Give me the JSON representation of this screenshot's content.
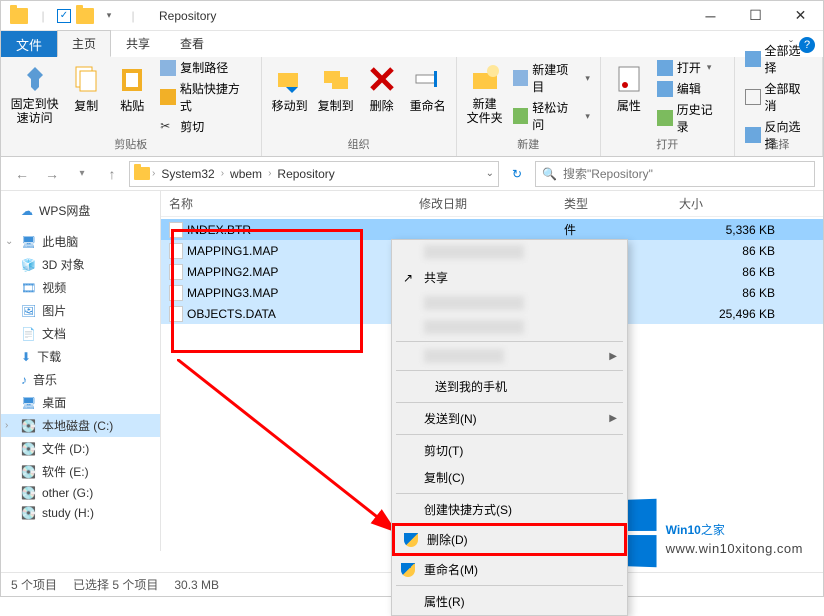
{
  "window": {
    "title": "Repository"
  },
  "tabs": {
    "file": "文件",
    "home": "主页",
    "share": "共享",
    "view": "查看"
  },
  "ribbon": {
    "pin": "固定到快\n速访问",
    "copy": "复制",
    "paste": "粘贴",
    "copypath": "复制路径",
    "pasteshortcut": "粘贴快捷方式",
    "cut": "剪切",
    "clipboard": "剪贴板",
    "moveto": "移动到",
    "copyto": "复制到",
    "delete": "删除",
    "rename": "重命名",
    "organize": "组织",
    "newfolder": "新建\n文件夹",
    "newitem": "新建项目",
    "easyaccess": "轻松访问",
    "new": "新建",
    "properties": "属性",
    "open": "打开",
    "edit": "编辑",
    "history": "历史记录",
    "opengrp": "打开",
    "selectall": "全部选择",
    "selectnone": "全部取消",
    "invertsel": "反向选择",
    "select": "选择"
  },
  "breadcrumb": {
    "seg1": "System32",
    "seg2": "wbem",
    "seg3": "Repository"
  },
  "search": {
    "placeholder": "搜索\"Repository\""
  },
  "columns": {
    "name": "名称",
    "date": "修改日期",
    "type": "类型",
    "size": "大小"
  },
  "sidebar": {
    "wps": "WPS网盘",
    "pc": "此电脑",
    "d3": "3D 对象",
    "video": "视频",
    "pic": "图片",
    "doc": "文档",
    "dl": "下载",
    "music": "音乐",
    "desktop": "桌面",
    "drivec": "本地磁盘 (C:)",
    "drived": "文件 (D:)",
    "drivee": "软件 (E:)",
    "driveg": "other (G:)",
    "driveh": "study (H:)"
  },
  "files": [
    {
      "name": "INDEX.BTR",
      "size": "5,336 KB"
    },
    {
      "name": "MAPPING1.MAP",
      "size": "86 KB"
    },
    {
      "name": "MAPPING2.MAP",
      "size": "86 KB"
    },
    {
      "name": "MAPPING3.MAP",
      "size": "86 KB"
    },
    {
      "name": "OBJECTS.DATA",
      "size": "25,496 KB"
    }
  ],
  "context": {
    "share": "共享",
    "sendphone": "送到我的手机",
    "sendto": "发送到(N)",
    "cut": "剪切(T)",
    "copy": "复制(C)",
    "shortcut": "创建快捷方式(S)",
    "delete": "删除(D)",
    "rename": "重命名(M)",
    "props": "属性(R)"
  },
  "status": {
    "items": "5 个项目",
    "selected": "已选择 5 个项目",
    "size": "30.3 MB"
  },
  "watermark": {
    "title_a": "Win10",
    "title_b": "之家",
    "url": "www.win10xitong.com"
  },
  "hidden_suffix": "件"
}
